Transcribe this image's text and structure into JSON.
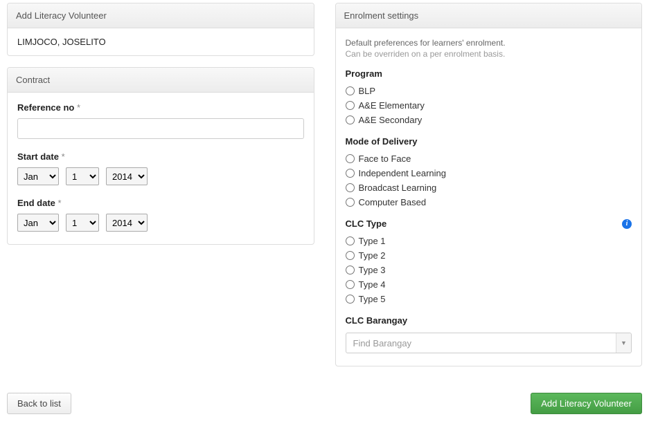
{
  "left": {
    "addVolunteer": {
      "title": "Add Literacy Volunteer",
      "name": "LIMJOCO, JOSELITO"
    },
    "contract": {
      "title": "Contract",
      "referenceLabel": "Reference no",
      "referenceValue": "",
      "startDateLabel": "Start date",
      "endDateLabel": "End date",
      "startMonth": "Jan",
      "startDay": "1",
      "startYear": "2014",
      "endMonth": "Jan",
      "endDay": "1",
      "endYear": "2014"
    }
  },
  "right": {
    "title": "Enrolment settings",
    "help1": "Default preferences for learners' enrolment.",
    "help2": "Can be overriden on a per enrolment basis.",
    "programLabel": "Program",
    "programs": [
      "BLP",
      "A&E Elementary",
      "A&E Secondary"
    ],
    "modeLabel": "Mode of Delivery",
    "modes": [
      "Face to Face",
      "Independent Learning",
      "Broadcast Learning",
      "Computer Based"
    ],
    "clcTypeLabel": "CLC Type",
    "clcTypes": [
      "Type 1",
      "Type 2",
      "Type 3",
      "Type 4",
      "Type 5"
    ],
    "clcBarangayLabel": "CLC Barangay",
    "barangayPlaceholder": "Find Barangay"
  },
  "footer": {
    "backLabel": "Back to list",
    "submitLabel": "Add Literacy Volunteer"
  }
}
